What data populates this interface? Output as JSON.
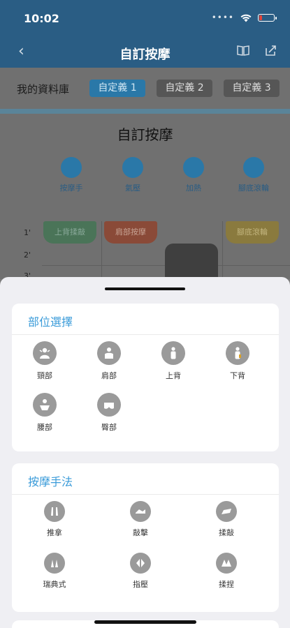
{
  "status": {
    "time": "10:02"
  },
  "nav": {
    "title": "自訂按摩"
  },
  "library": {
    "label": "我的資料庫",
    "tabs": [
      {
        "label": "自定義 1",
        "active": true
      },
      {
        "label": "自定義 2",
        "active": false
      },
      {
        "label": "自定義 3",
        "active": false
      }
    ]
  },
  "editor": {
    "title": "自訂按摩",
    "functions": [
      {
        "label": "按摩手"
      },
      {
        "label": "氣壓"
      },
      {
        "label": "加熱"
      },
      {
        "label": "腳底滾輪"
      }
    ],
    "timeline_numbers": [
      "1'",
      "2'",
      "3'"
    ],
    "blocks": [
      "上背揉敲",
      "肩部按摩",
      "",
      "腳底滾輪"
    ]
  },
  "sheet": {
    "sections": [
      {
        "title": "部位選擇",
        "items": [
          {
            "label": "頸部",
            "icon": "neck-icon"
          },
          {
            "label": "肩部",
            "icon": "shoulder-icon"
          },
          {
            "label": "上背",
            "icon": "upper-back-icon"
          },
          {
            "label": "下背",
            "icon": "lower-back-icon"
          },
          {
            "label": "腰部",
            "icon": "waist-icon"
          },
          {
            "label": "臀部",
            "icon": "hip-icon"
          }
        ]
      },
      {
        "title": "按摩手法",
        "items": [
          {
            "label": "推拿",
            "icon": "push-icon"
          },
          {
            "label": "敲擊",
            "icon": "tap-icon"
          },
          {
            "label": "揉敲",
            "icon": "knead-tap-icon"
          },
          {
            "label": "瑞典式",
            "icon": "swedish-icon"
          },
          {
            "label": "指壓",
            "icon": "shiatsu-icon"
          },
          {
            "label": "揉捏",
            "icon": "knead-icon"
          }
        ]
      }
    ]
  },
  "colors": {
    "accent": "#3a9bd9",
    "navbar": "#2a5d84",
    "icon_bg": "#9a9a9a"
  }
}
